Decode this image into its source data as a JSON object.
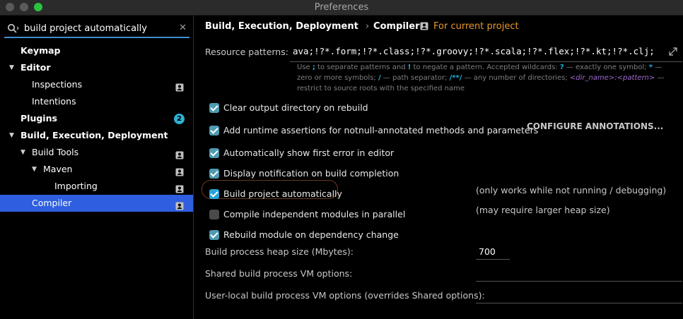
{
  "window": {
    "title": "Preferences"
  },
  "sidebar": {
    "search_value": "build project automatically",
    "items": [
      {
        "label": "Keymap",
        "indent": 0,
        "arrow": "",
        "bold": true,
        "project": false,
        "badge": ""
      },
      {
        "label": "Editor",
        "indent": 0,
        "arrow": "▼",
        "bold": true,
        "project": false,
        "badge": ""
      },
      {
        "label": "Inspections",
        "indent": 1,
        "arrow": "",
        "bold": false,
        "project": true,
        "badge": ""
      },
      {
        "label": "Intentions",
        "indent": 1,
        "arrow": "",
        "bold": false,
        "project": false,
        "badge": ""
      },
      {
        "label": "Plugins",
        "indent": 0,
        "arrow": "",
        "bold": true,
        "project": false,
        "badge": "2"
      },
      {
        "label": "Build, Execution, Deployment",
        "indent": 0,
        "arrow": "▼",
        "bold": true,
        "project": false,
        "badge": ""
      },
      {
        "label": "Build Tools",
        "indent": 1,
        "arrow": "▼",
        "bold": false,
        "project": true,
        "badge": ""
      },
      {
        "label": "Maven",
        "indent": 2,
        "arrow": "▼",
        "bold": false,
        "project": true,
        "badge": ""
      },
      {
        "label": "Importing",
        "indent": 3,
        "arrow": "",
        "bold": false,
        "project": true,
        "badge": ""
      },
      {
        "label": "Compiler",
        "indent": 1,
        "arrow": "",
        "bold": false,
        "project": true,
        "badge": "",
        "selected": true
      }
    ]
  },
  "main": {
    "breadcrumb": {
      "parent": "Build, Execution, Deployment",
      "separator": "›",
      "current": "Compiler"
    },
    "scope": "For current project",
    "resource_patterns": {
      "label": "Resource patterns:",
      "value": "ava;!?*.form;!?*.class;!?*.groovy;!?*.scala;!?*.flex;!?*.kt;!?*.clj;",
      "hint_parts": [
        "Use ",
        ";",
        " to separate patterns and ",
        "!",
        " to negate a pattern. Accepted wildcards: ",
        "?",
        " — exactly one symbol; ",
        "*",
        " — zero or more symbols; ",
        "/",
        " — path separator; ",
        "/**/",
        " — any number of directories; ",
        "<dir_name>:<pattern>",
        " — restrict to source roots with the specified name"
      ]
    },
    "options": [
      {
        "label": "Clear output directory on rebuild",
        "checked": true
      },
      {
        "label": "Add runtime assertions for notnull-annotated methods and parameters",
        "checked": true
      },
      {
        "label": "Automatically show first error in editor",
        "checked": true
      },
      {
        "label": "Display notification on build completion",
        "checked": true
      },
      {
        "label": "Build project automatically",
        "checked": true,
        "focused": true
      },
      {
        "label": "Compile independent modules in parallel",
        "checked": false
      },
      {
        "label": "Rebuild module on dependency change",
        "checked": true
      }
    ],
    "configure_annotations": "CONFIGURE ANNOTATIONS...",
    "notes": {
      "build_auto": "(only works while not running / debugging)",
      "parallel": "(may require larger heap size)"
    },
    "heap_size": {
      "label": "Build process heap size (Mbytes):",
      "value": "700"
    },
    "shared_vm": {
      "label": "Shared build process VM options:",
      "value": ""
    },
    "user_vm": {
      "label": "User-local build process VM options (overrides Shared options):",
      "value": ""
    }
  }
}
